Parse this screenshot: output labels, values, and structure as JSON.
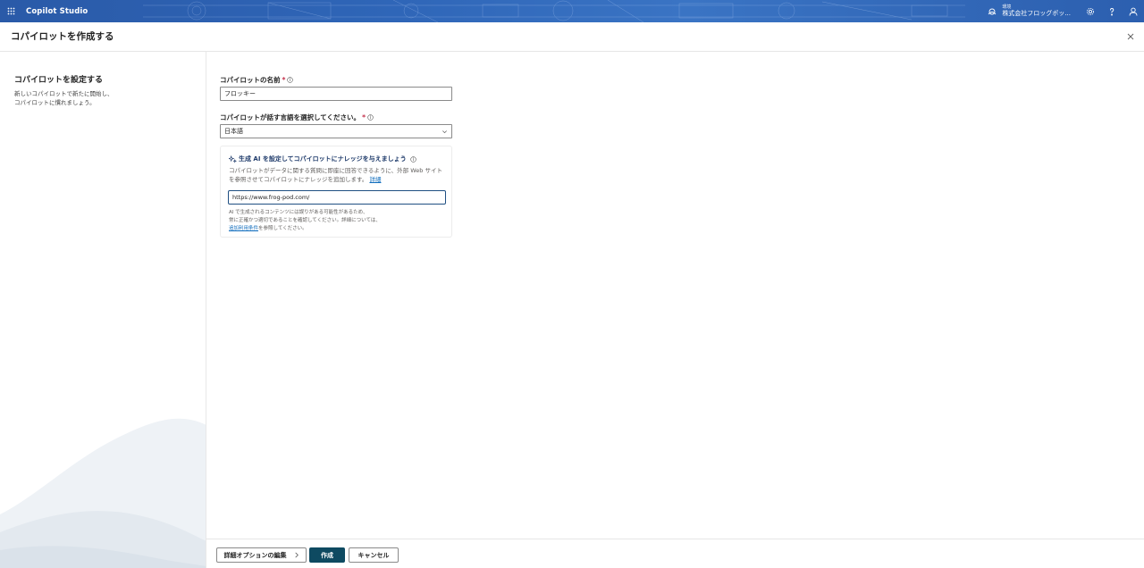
{
  "topbar": {
    "app_name": "Copilot Studio",
    "env_label": "環境",
    "env_name": "株式会社フロッグポッ...",
    "icons": [
      "waffle-icon",
      "environment-icon",
      "settings-icon",
      "help-icon",
      "account-icon"
    ]
  },
  "header": {
    "title": "コパイロットを作成する"
  },
  "left": {
    "title": "コパイロットを設定する",
    "desc_line1": "新しいコパイロットで新たに開始し、",
    "desc_line2": "コパイロットに慣れましょう。"
  },
  "form": {
    "name_label": "コパイロットの名前",
    "name_value": "フロッキー",
    "lang_label": "コパイロットが話す言語を選択してください。",
    "lang_value": "日本語",
    "required_mark": "*"
  },
  "ai_card": {
    "title": "生成 AI を設定してコパイロットにナレッジを与えましょう",
    "desc": "コパイロットがデータに関する質問に即座に回答できるように、外部 Web サイトを参照させてコパイロットにナレッジを追加します。",
    "desc_link": "詳細",
    "url_value": "https://www.frog-pod.com/",
    "note_line1": "AI で生成されるコンテンツには誤りがある可能性があるため、",
    "note_line2": "常に正確かつ適切であることを確認してください。詳細については、",
    "note_link": "追加利用条件",
    "note_line3_suffix": "を参照してください。"
  },
  "footer": {
    "advanced_label": "詳細オプションの編集",
    "create_label": "作成",
    "cancel_label": "キャンセル"
  },
  "colors": {
    "topbar": "#2f66b8",
    "primary_button": "#0e4a61",
    "link": "#0f6cbd",
    "required": "#c4314b"
  }
}
